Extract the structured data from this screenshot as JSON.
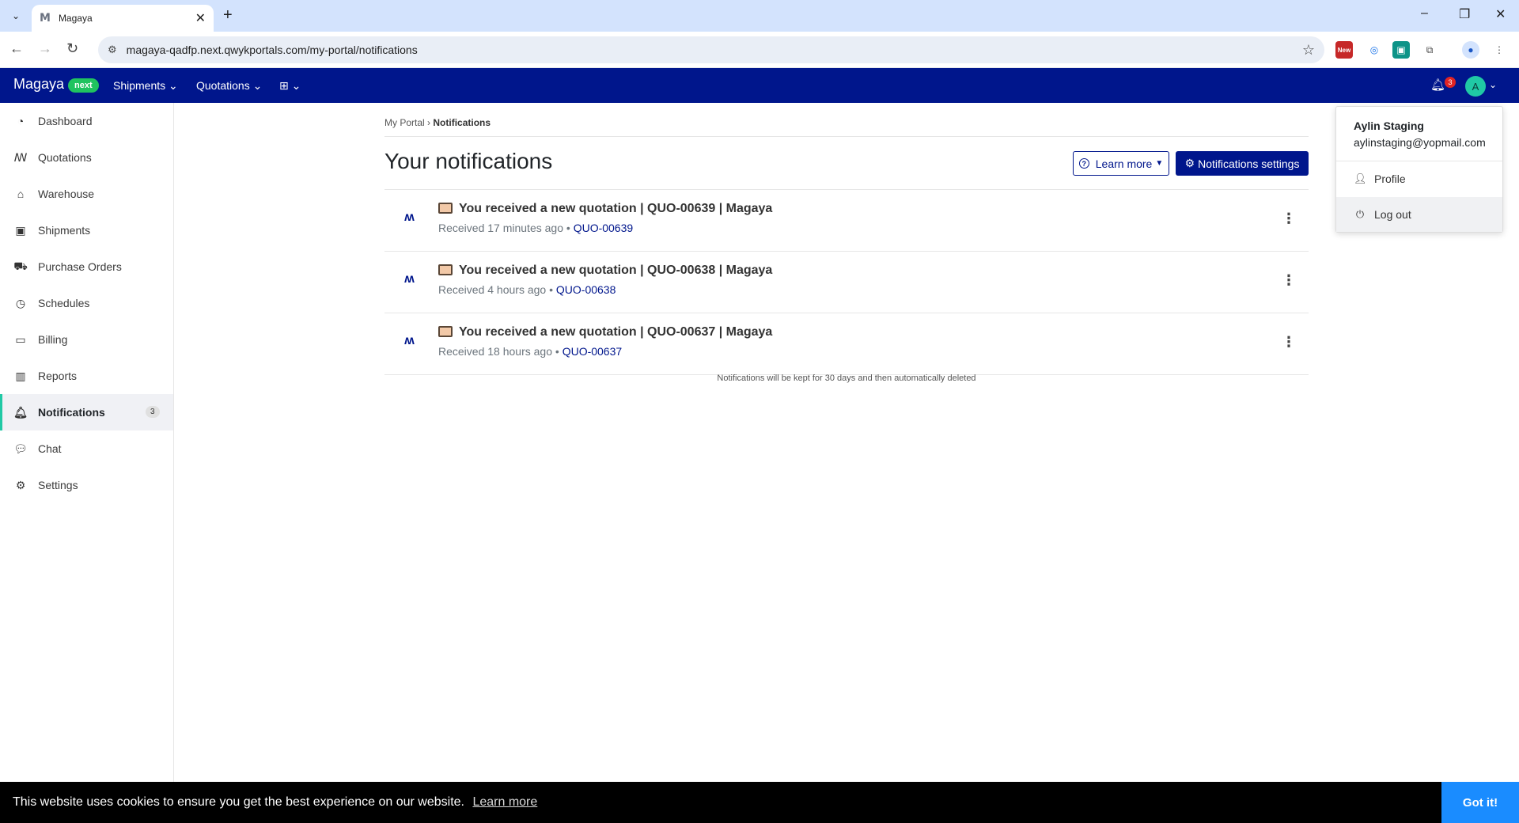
{
  "browser": {
    "tab_title": "Magaya",
    "tab_favicon": "M",
    "url": "magaya-qadfp.next.qwykportals.com/my-portal/notifications",
    "ext_badge": "New"
  },
  "header": {
    "brand": "Magaya",
    "brand_badge": "next",
    "nav": [
      {
        "label": "Shipments"
      },
      {
        "label": "Quotations"
      }
    ],
    "notification_count": "3",
    "avatar_initial": "A",
    "brand_color": "#00168c",
    "accent_color": "#20c9a5"
  },
  "sidebar": {
    "items": [
      {
        "label": "Dashboard",
        "icon": "gauge-icon"
      },
      {
        "label": "Quotations",
        "icon": "hands-icon"
      },
      {
        "label": "Warehouse",
        "icon": "warehouse-icon"
      },
      {
        "label": "Shipments",
        "icon": "box-icon"
      },
      {
        "label": "Purchase Orders",
        "icon": "cart-icon"
      },
      {
        "label": "Schedules",
        "icon": "clock-icon"
      },
      {
        "label": "Billing",
        "icon": "credit-card-icon"
      },
      {
        "label": "Reports",
        "icon": "bar-chart-icon"
      },
      {
        "label": "Notifications",
        "icon": "bell-icon",
        "badge": "3",
        "active": true
      },
      {
        "label": "Chat",
        "icon": "chat-icon"
      },
      {
        "label": "Settings",
        "icon": "gear-icon"
      }
    ]
  },
  "main": {
    "breadcrumb_root": "My Portal",
    "breadcrumb_sep": "›",
    "breadcrumb_current": "Notifications",
    "title": "Your notifications",
    "learn_more": "Learn more",
    "settings_button": "Notifications settings",
    "notifications": [
      {
        "title": "You received a new quotation | QUO-00639 | Magaya",
        "received": "Received 17 minutes ago",
        "sep": "•",
        "ref": "QUO-00639"
      },
      {
        "title": "You received a new quotation | QUO-00638 | Magaya",
        "received": "Received 4 hours ago",
        "sep": "•",
        "ref": "QUO-00638"
      },
      {
        "title": "You received a new quotation | QUO-00637 | Magaya",
        "received": "Received 18 hours ago",
        "sep": "•",
        "ref": "QUO-00637"
      }
    ],
    "retention_note": "Notifications will be kept for 30 days and then automatically deleted"
  },
  "user_menu": {
    "name": "Aylin Staging",
    "email": "aylinstaging@yopmail.com",
    "profile": "Profile",
    "logout": "Log out"
  },
  "cookie": {
    "message": "This website uses cookies to ensure you get the best experience on our website.",
    "learn_more": "Learn more",
    "accept": "Got it!"
  }
}
